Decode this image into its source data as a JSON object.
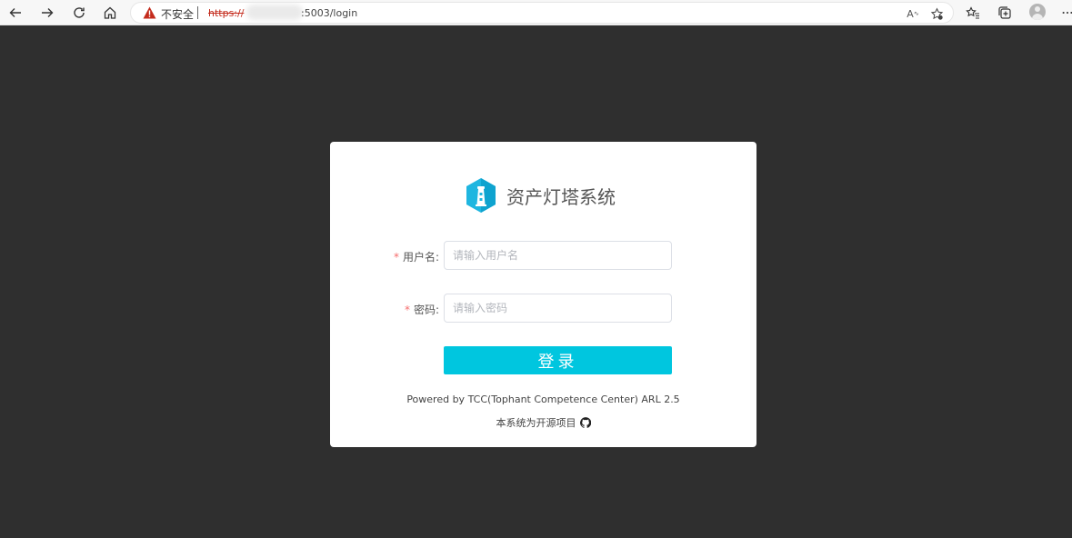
{
  "browser": {
    "security_label": "不安全",
    "url_scheme": "https://",
    "url_rest": ":5003/login",
    "read_aloud_label": "A"
  },
  "login": {
    "brand": "资产灯塔系统",
    "username_label": "用户名:",
    "username_placeholder": "请输入用户名",
    "password_label": "密码:",
    "password_placeholder": "请输入密码",
    "required_mark": "*",
    "submit_label": "登录",
    "powered_by": "Powered by TCC(Tophant Competence Center) ARL 2.5",
    "open_source_note": "本系统为开源项目"
  },
  "colors": {
    "page_background": "#2f2f2f",
    "accent": "#00c6df",
    "required": "#f56c6c",
    "warning": "#c42b1c"
  },
  "icons": [
    "back-icon",
    "forward-icon",
    "refresh-icon",
    "home-icon",
    "warning-icon",
    "read-aloud-icon",
    "favorite-add-icon",
    "favorites-icon",
    "collections-icon",
    "profile-avatar",
    "more-icon",
    "lighthouse-logo-icon",
    "github-icon"
  ]
}
